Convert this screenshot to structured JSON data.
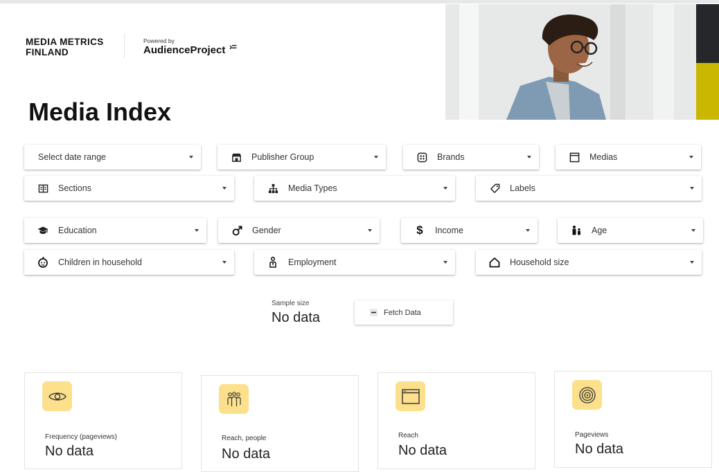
{
  "brand": {
    "line1": "MEDIA METRICS",
    "line2": "FINLAND",
    "powered_by": "Powered by",
    "partner": "AudienceProject",
    "partner_mark": "›="
  },
  "page_title": "Media Index",
  "filters": {
    "date_range": "Select date range",
    "publisher_group": "Publisher Group",
    "brands": "Brands",
    "medias": "Medias",
    "sections": "Sections",
    "media_types": "Media Types",
    "labels": "Labels",
    "education": "Education",
    "gender": "Gender",
    "income": "Income",
    "age": "Age",
    "children": "Children in household",
    "employment": "Employment",
    "household_size": "Household size"
  },
  "sample": {
    "label": "Sample size",
    "value": "No data"
  },
  "fetch_label": "Fetch Data",
  "cards": [
    {
      "label": "Frequency (pageviews)",
      "value": "No data",
      "icon": "eye-icon"
    },
    {
      "label": "Reach, people",
      "value": "No data",
      "icon": "people-icon"
    },
    {
      "label": "Reach",
      "value": "No data",
      "icon": "browser-window-icon"
    },
    {
      "label": "Pageviews",
      "value": "No data",
      "icon": "target-icon"
    }
  ],
  "colors": {
    "card_icon_bg": "#fce08c",
    "hero_stripe_dark": "#25272a",
    "hero_stripe_yellow": "#c9b700"
  }
}
